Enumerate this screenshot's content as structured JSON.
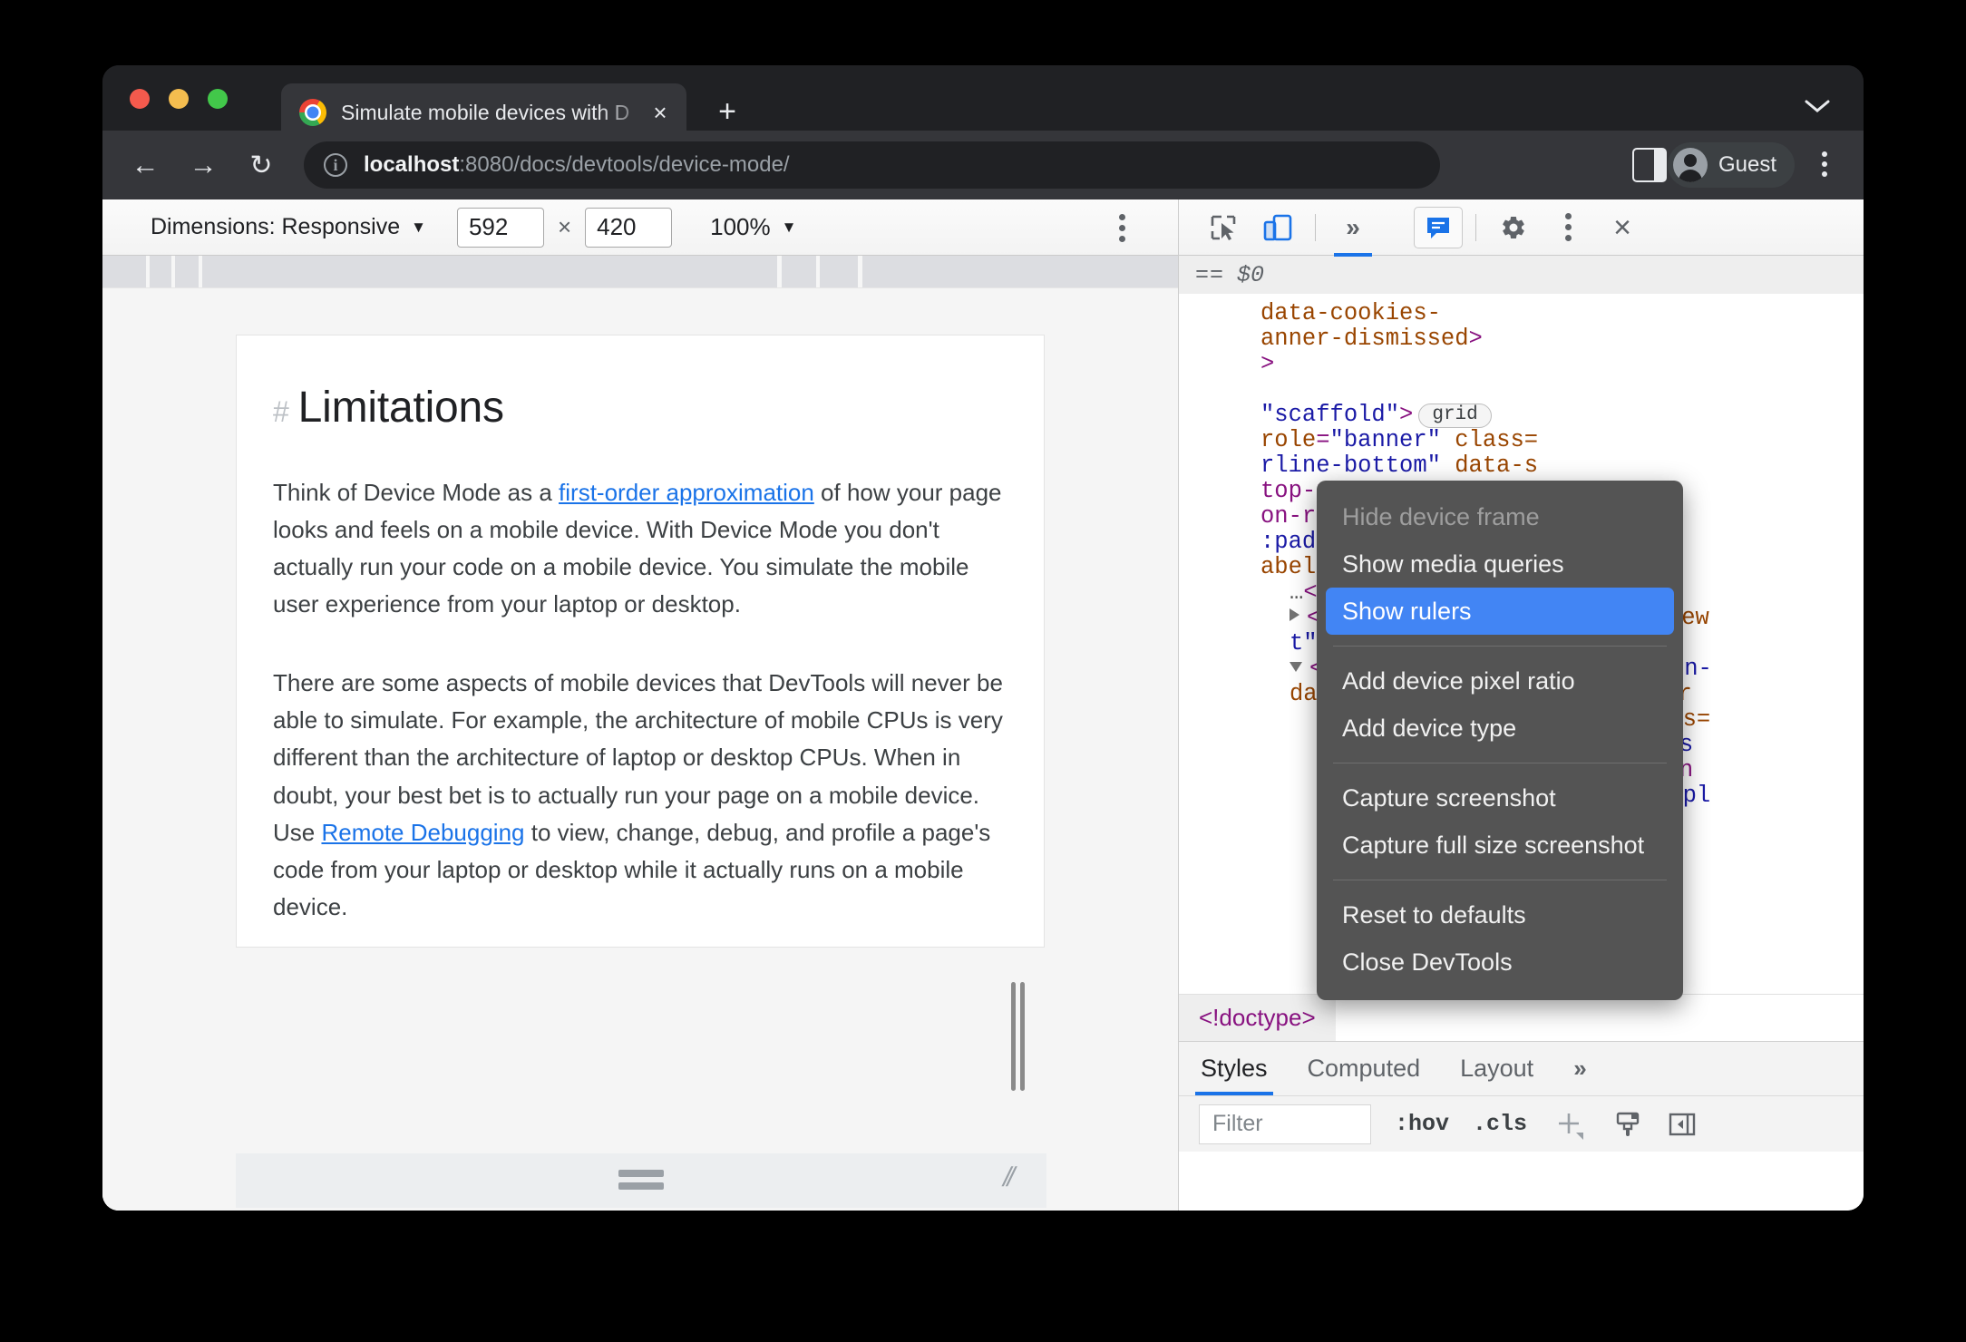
{
  "browser": {
    "tab": {
      "title": "Simulate mobile devices with D",
      "close_label": "×",
      "logo_icon": "chrome-logo-icon"
    },
    "new_tab_label": "+",
    "window_chevron": "⌄",
    "nav": {
      "back": "←",
      "forward": "→",
      "reload": "↻"
    },
    "omnibox": {
      "site_info_icon": "info-icon",
      "url_host": "localhost",
      "url_path": ":8080/docs/devtools/device-mode/"
    },
    "profile_name": "Guest"
  },
  "device_toolbar": {
    "dimensions_label": "Dimensions: Responsive",
    "dimensions_caret": "▼",
    "width_value": "592",
    "times": "×",
    "height_value": "420",
    "zoom_level": "100%",
    "zoom_caret": "▼",
    "more_options_icon": "three-dot-menu-icon"
  },
  "context_menu": {
    "items": [
      {
        "label": "Hide device frame",
        "state": "disabled"
      },
      {
        "label": "Show media queries",
        "state": "normal"
      },
      {
        "label": "Show rulers",
        "state": "selected"
      },
      {
        "label": "separator",
        "state": "separator"
      },
      {
        "label": "Add device pixel ratio",
        "state": "normal"
      },
      {
        "label": "Add device type",
        "state": "normal"
      },
      {
        "label": "separator",
        "state": "separator"
      },
      {
        "label": "Capture screenshot",
        "state": "normal"
      },
      {
        "label": "Capture full size screenshot",
        "state": "normal"
      },
      {
        "label": "separator",
        "state": "separator"
      },
      {
        "label": "Reset to defaults",
        "state": "normal"
      },
      {
        "label": "Close DevTools",
        "state": "normal"
      }
    ],
    "highlight_color": "#4285f4",
    "background_color": "#545454"
  },
  "page": {
    "heading_hash": "#",
    "heading": "Limitations",
    "paragraph1_pre": "Think of Device Mode as a ",
    "paragraph1_link": "first-order approximation",
    "paragraph1_post": " of how your page looks and feels on a mobile device. With Device Mode you don't actually run your code on a mobile device. You simulate the mobile user experience from your laptop or desktop.",
    "paragraph2_pre": "There are some aspects of mobile devices that DevTools will never be able to simulate. For example, the architecture of mobile CPUs is very different than the architecture of laptop or desktop CPUs. When in doubt, your best bet is to actually run your page on a mobile device. Use ",
    "paragraph2_link": "Remote Debugging",
    "paragraph2_post": " to view, change, debug, and profile a page's code from your laptop or desktop while it actually runs on a mobile device.",
    "link_color": "#1a73e8"
  },
  "devtools_toolbar": {
    "inspect_icon": "inspect-element-icon",
    "device_toggle_icon": "device-toolbar-icon",
    "more_panels_icon": "»",
    "issues_icon": "issues-message-icon",
    "settings_icon": "gear-icon",
    "more_icon": "three-dot-menu-icon",
    "close_icon": "×"
  },
  "inspector": {
    "selected_node_eq": "==",
    "selected_node_var": "$0",
    "dom_lines": [
      {
        "indent": 0,
        "tri": "none",
        "html": "<span class=\"attr\">data-cookies-</span>"
      },
      {
        "indent": 0,
        "tri": "none",
        "html": "<span class=\"attr\">anner-dismissed</span><span class=\"punct\">&gt;</span>"
      },
      {
        "indent": 0,
        "tri": "none",
        "html": "<span class=\"punct\">&gt;</span>"
      },
      {
        "indent": 0,
        "tri": "none",
        "html": ""
      },
      {
        "indent": 0,
        "tri": "none",
        "html": "<span class=\"val\">\"scaffold\"</span><span class=\"punct\">&gt;</span><span class=\"badge-grid\">grid</span>"
      },
      {
        "indent": 0,
        "tri": "none",
        "html": "<span class=\"attr\">role</span><span class=\"punct\">=</span><span class=\"val\">\"banner\"</span> <span class=\"attr\">class=</span>"
      },
      {
        "indent": 0,
        "tri": "none",
        "html": "<span class=\"val\">rline-bottom\"</span> <span class=\"attr\">data-s</span>"
      },
      {
        "indent": 0,
        "tri": "none",
        "html": "<span class=\"tag\">top-nav&gt;</span>"
      },
      {
        "indent": 0,
        "tri": "none",
        "html": "<span class=\"tag\">on-rail</span> <span class=\"attr\">role</span><span class=\"punct\">=</span><span class=\"val\">\"naviga</span>"
      },
      {
        "indent": 0,
        "tri": "none",
        "html": "<span class=\"val\">:pad-left-200 lg:pad</span>"
      },
      {
        "indent": 0,
        "tri": "none",
        "html": "<span class=\"attr\">abel</span><span class=\"punct\">=</span><span class=\"val\">\"primary\"</span> <span class=\"attr\">tabin</span>"
      },
      {
        "indent": 1,
        "tri": "none",
        "html": "<span class=\"ellipsis\">…</span><span class=\"tag\">&lt;/navigation-rail&gt;</span>"
      },
      {
        "indent": 1,
        "tri": "right",
        "html": "<span class=\"tag\">&lt;side-nav</span> <span class=\"attr\">type</span><span class=\"punct\">=</span><span class=\"val\">\"project\"</span> <span class=\"attr\">view</span>"
      },
      {
        "indent": 1,
        "tri": "none",
        "html": "<span class=\"val\">t\"</span><span class=\"punct\">&gt;</span><span class=\"ellipsis\">…</span><span class=\"tag\">&lt;/side-nav&gt;</span>"
      },
      {
        "indent": 1,
        "tri": "down",
        "html": "<span class=\"tag\">&lt;main</span> <span class=\"attr\">tabindex</span><span class=\"punct\">=</span><span class=\"val\">\"-1\"</span> <span class=\"attr\">id</span><span class=\"punct\">=</span><span class=\"val\">\"main-</span>"
      },
      {
        "indent": 1,
        "tri": "none",
        "html": "<span class=\"attr\">data-side-nav-inert data-sear</span>"
      },
      {
        "indent": 2,
        "tri": "right",
        "html": "<span class=\"tag\">&lt;announcement-banner</span> <span class=\"attr\">class=</span>"
      },
      {
        "indent": 2,
        "tri": "none",
        "html": "<span class=\"val\">nner--info\"</span> <span class=\"attr\">storage-key</span><span class=\"punct\">=</span><span class=\"val\">\"us</span>"
      },
      {
        "indent": 2,
        "tri": "none",
        "html": "<span class=\"attr\">active</span><span class=\"punct\">&gt;</span><span class=\"ellipsis\">…</span><span class=\"tag\">&lt;/announcement-bann</span>"
      },
      {
        "indent": 2,
        "tri": "right",
        "html": "<span class=\"tag\">&lt;div</span> <span class=\"attr\">class</span><span class=\"punct\">=</span><span class=\"val\">\"title-bar displ</span>"
      }
    ],
    "breadcrumb_doctype": "<!doctype>",
    "styles_tabs": [
      {
        "label": "Styles",
        "active": true
      },
      {
        "label": "Computed",
        "active": false
      },
      {
        "label": "Layout",
        "active": false
      }
    ],
    "styles_more": "»",
    "filter_placeholder": "Filter",
    "hov_label": ":hov",
    "cls_label": ".cls",
    "new_rule_icon": "plus-icon",
    "copy_styles_icon": "paintbrush-icon",
    "toggle_sidebar_icon": "toggle-sidebar-icon"
  }
}
